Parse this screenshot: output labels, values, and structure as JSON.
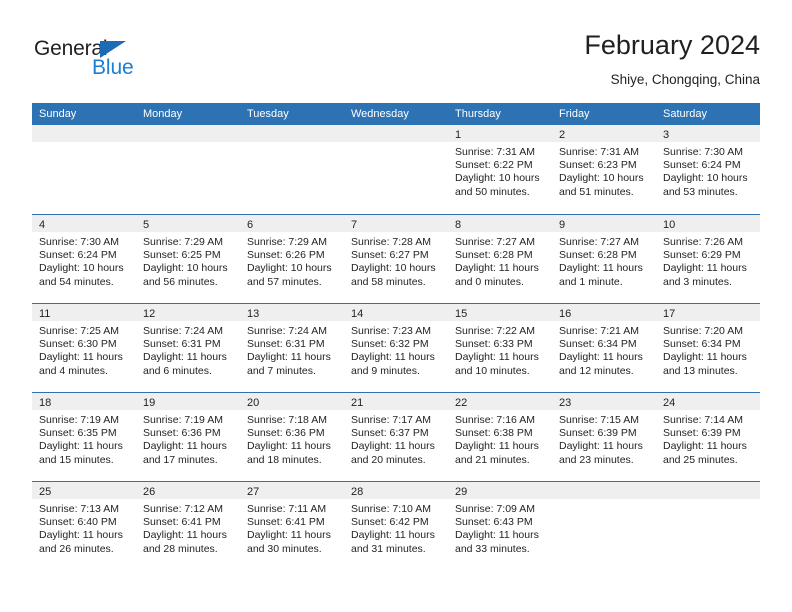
{
  "logo": {
    "word_one": "General",
    "word_two": "Blue",
    "triangle_color": "#1b6cb5",
    "blue_color": "#1b7fd4"
  },
  "header": {
    "title": "February 2024",
    "subtitle": "Shiye, Chongqing, China"
  },
  "theme": {
    "header_blue": "#2d72b3",
    "day_band_gray": "#efefef",
    "text": "#231f20"
  },
  "weekday_headers": [
    "Sunday",
    "Monday",
    "Tuesday",
    "Wednesday",
    "Thursday",
    "Friday",
    "Saturday"
  ],
  "weeks": [
    [
      {
        "day": "",
        "sunrise": "",
        "sunset": "",
        "daylight_line1": "",
        "daylight_line2": ""
      },
      {
        "day": "",
        "sunrise": "",
        "sunset": "",
        "daylight_line1": "",
        "daylight_line2": ""
      },
      {
        "day": "",
        "sunrise": "",
        "sunset": "",
        "daylight_line1": "",
        "daylight_line2": ""
      },
      {
        "day": "",
        "sunrise": "",
        "sunset": "",
        "daylight_line1": "",
        "daylight_line2": ""
      },
      {
        "day": "1",
        "sunrise": "Sunrise: 7:31 AM",
        "sunset": "Sunset: 6:22 PM",
        "daylight_line1": "Daylight: 10 hours",
        "daylight_line2": "and 50 minutes."
      },
      {
        "day": "2",
        "sunrise": "Sunrise: 7:31 AM",
        "sunset": "Sunset: 6:23 PM",
        "daylight_line1": "Daylight: 10 hours",
        "daylight_line2": "and 51 minutes."
      },
      {
        "day": "3",
        "sunrise": "Sunrise: 7:30 AM",
        "sunset": "Sunset: 6:24 PM",
        "daylight_line1": "Daylight: 10 hours",
        "daylight_line2": "and 53 minutes."
      }
    ],
    [
      {
        "day": "4",
        "sunrise": "Sunrise: 7:30 AM",
        "sunset": "Sunset: 6:24 PM",
        "daylight_line1": "Daylight: 10 hours",
        "daylight_line2": "and 54 minutes."
      },
      {
        "day": "5",
        "sunrise": "Sunrise: 7:29 AM",
        "sunset": "Sunset: 6:25 PM",
        "daylight_line1": "Daylight: 10 hours",
        "daylight_line2": "and 56 minutes."
      },
      {
        "day": "6",
        "sunrise": "Sunrise: 7:29 AM",
        "sunset": "Sunset: 6:26 PM",
        "daylight_line1": "Daylight: 10 hours",
        "daylight_line2": "and 57 minutes."
      },
      {
        "day": "7",
        "sunrise": "Sunrise: 7:28 AM",
        "sunset": "Sunset: 6:27 PM",
        "daylight_line1": "Daylight: 10 hours",
        "daylight_line2": "and 58 minutes."
      },
      {
        "day": "8",
        "sunrise": "Sunrise: 7:27 AM",
        "sunset": "Sunset: 6:28 PM",
        "daylight_line1": "Daylight: 11 hours",
        "daylight_line2": "and 0 minutes."
      },
      {
        "day": "9",
        "sunrise": "Sunrise: 7:27 AM",
        "sunset": "Sunset: 6:28 PM",
        "daylight_line1": "Daylight: 11 hours",
        "daylight_line2": "and 1 minute."
      },
      {
        "day": "10",
        "sunrise": "Sunrise: 7:26 AM",
        "sunset": "Sunset: 6:29 PM",
        "daylight_line1": "Daylight: 11 hours",
        "daylight_line2": "and 3 minutes."
      }
    ],
    [
      {
        "day": "11",
        "sunrise": "Sunrise: 7:25 AM",
        "sunset": "Sunset: 6:30 PM",
        "daylight_line1": "Daylight: 11 hours",
        "daylight_line2": "and 4 minutes."
      },
      {
        "day": "12",
        "sunrise": "Sunrise: 7:24 AM",
        "sunset": "Sunset: 6:31 PM",
        "daylight_line1": "Daylight: 11 hours",
        "daylight_line2": "and 6 minutes."
      },
      {
        "day": "13",
        "sunrise": "Sunrise: 7:24 AM",
        "sunset": "Sunset: 6:31 PM",
        "daylight_line1": "Daylight: 11 hours",
        "daylight_line2": "and 7 minutes."
      },
      {
        "day": "14",
        "sunrise": "Sunrise: 7:23 AM",
        "sunset": "Sunset: 6:32 PM",
        "daylight_line1": "Daylight: 11 hours",
        "daylight_line2": "and 9 minutes."
      },
      {
        "day": "15",
        "sunrise": "Sunrise: 7:22 AM",
        "sunset": "Sunset: 6:33 PM",
        "daylight_line1": "Daylight: 11 hours",
        "daylight_line2": "and 10 minutes."
      },
      {
        "day": "16",
        "sunrise": "Sunrise: 7:21 AM",
        "sunset": "Sunset: 6:34 PM",
        "daylight_line1": "Daylight: 11 hours",
        "daylight_line2": "and 12 minutes."
      },
      {
        "day": "17",
        "sunrise": "Sunrise: 7:20 AM",
        "sunset": "Sunset: 6:34 PM",
        "daylight_line1": "Daylight: 11 hours",
        "daylight_line2": "and 13 minutes."
      }
    ],
    [
      {
        "day": "18",
        "sunrise": "Sunrise: 7:19 AM",
        "sunset": "Sunset: 6:35 PM",
        "daylight_line1": "Daylight: 11 hours",
        "daylight_line2": "and 15 minutes."
      },
      {
        "day": "19",
        "sunrise": "Sunrise: 7:19 AM",
        "sunset": "Sunset: 6:36 PM",
        "daylight_line1": "Daylight: 11 hours",
        "daylight_line2": "and 17 minutes."
      },
      {
        "day": "20",
        "sunrise": "Sunrise: 7:18 AM",
        "sunset": "Sunset: 6:36 PM",
        "daylight_line1": "Daylight: 11 hours",
        "daylight_line2": "and 18 minutes."
      },
      {
        "day": "21",
        "sunrise": "Sunrise: 7:17 AM",
        "sunset": "Sunset: 6:37 PM",
        "daylight_line1": "Daylight: 11 hours",
        "daylight_line2": "and 20 minutes."
      },
      {
        "day": "22",
        "sunrise": "Sunrise: 7:16 AM",
        "sunset": "Sunset: 6:38 PM",
        "daylight_line1": "Daylight: 11 hours",
        "daylight_line2": "and 21 minutes."
      },
      {
        "day": "23",
        "sunrise": "Sunrise: 7:15 AM",
        "sunset": "Sunset: 6:39 PM",
        "daylight_line1": "Daylight: 11 hours",
        "daylight_line2": "and 23 minutes."
      },
      {
        "day": "24",
        "sunrise": "Sunrise: 7:14 AM",
        "sunset": "Sunset: 6:39 PM",
        "daylight_line1": "Daylight: 11 hours",
        "daylight_line2": "and 25 minutes."
      }
    ],
    [
      {
        "day": "25",
        "sunrise": "Sunrise: 7:13 AM",
        "sunset": "Sunset: 6:40 PM",
        "daylight_line1": "Daylight: 11 hours",
        "daylight_line2": "and 26 minutes."
      },
      {
        "day": "26",
        "sunrise": "Sunrise: 7:12 AM",
        "sunset": "Sunset: 6:41 PM",
        "daylight_line1": "Daylight: 11 hours",
        "daylight_line2": "and 28 minutes."
      },
      {
        "day": "27",
        "sunrise": "Sunrise: 7:11 AM",
        "sunset": "Sunset: 6:41 PM",
        "daylight_line1": "Daylight: 11 hours",
        "daylight_line2": "and 30 minutes."
      },
      {
        "day": "28",
        "sunrise": "Sunrise: 7:10 AM",
        "sunset": "Sunset: 6:42 PM",
        "daylight_line1": "Daylight: 11 hours",
        "daylight_line2": "and 31 minutes."
      },
      {
        "day": "29",
        "sunrise": "Sunrise: 7:09 AM",
        "sunset": "Sunset: 6:43 PM",
        "daylight_line1": "Daylight: 11 hours",
        "daylight_line2": "and 33 minutes."
      },
      {
        "day": "",
        "sunrise": "",
        "sunset": "",
        "daylight_line1": "",
        "daylight_line2": ""
      },
      {
        "day": "",
        "sunrise": "",
        "sunset": "",
        "daylight_line1": "",
        "daylight_line2": ""
      }
    ]
  ]
}
